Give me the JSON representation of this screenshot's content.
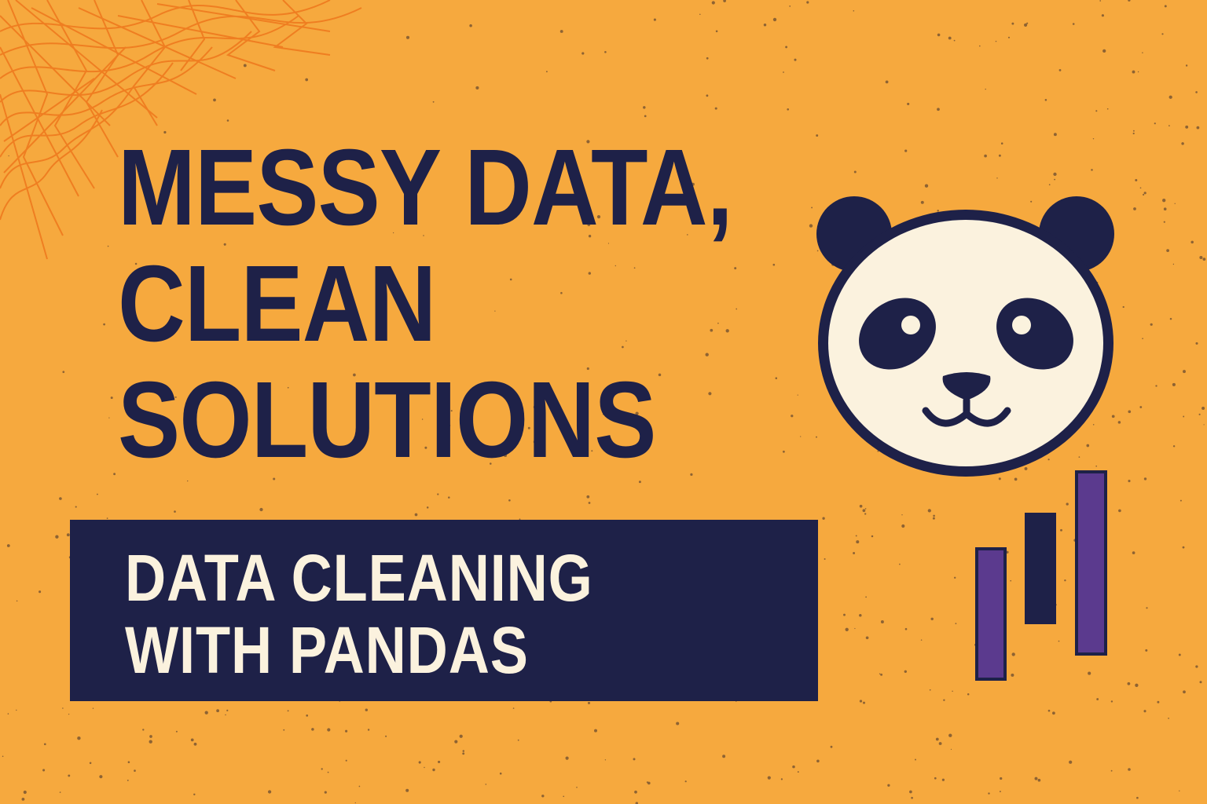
{
  "headline": {
    "line1": "MESSY DATA,",
    "line2": "CLEAN",
    "line3": "SOLUTIONS"
  },
  "banner": {
    "line1": "DATA CLEANING",
    "line2": "WITH PANDAS"
  },
  "colors": {
    "background": "#F6A93E",
    "navy": "#1E2148",
    "cream": "#FBF2DE",
    "purple": "#5B3A8E",
    "scribble": "#EF7A1E"
  },
  "icons": [
    "panda-face-icon",
    "bar-chart-icon"
  ]
}
